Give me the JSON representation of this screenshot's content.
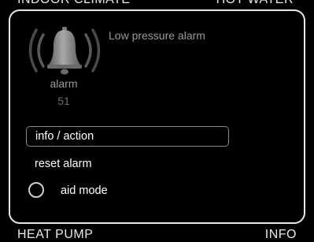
{
  "background_labels": {
    "top_left": "INDOOR CLIMATE",
    "top_right": "HOT WATER",
    "bottom_left": "HEAT PUMP",
    "bottom_right": "INFO"
  },
  "alarm": {
    "title": "Low pressure alarm",
    "label": "alarm",
    "code": "51",
    "icon": "alarm-bell-icon"
  },
  "menu": {
    "items": [
      {
        "label": "info / action",
        "selected": true
      },
      {
        "label": "reset alarm",
        "selected": false
      },
      {
        "label": "aid mode",
        "selected": false,
        "radio": true
      }
    ]
  },
  "colors": {
    "background": "#000000",
    "border": "#e6e6e6",
    "muted_text": "#9a9a9a",
    "bell": "#7a7a7a"
  }
}
